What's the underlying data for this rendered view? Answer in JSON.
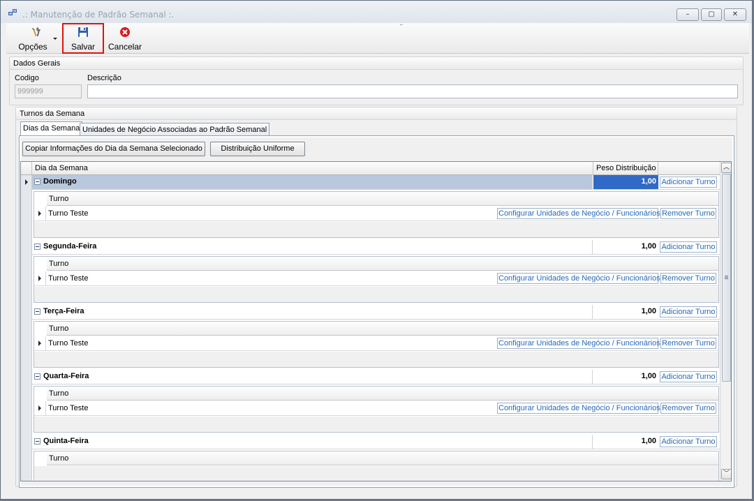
{
  "window": {
    "title": ".: Manutenção de Padrão Semanal :.",
    "controls": {
      "minimize": "–",
      "maximize": "▢",
      "close": "✕"
    }
  },
  "toolbar": {
    "options_label": "Opções",
    "save_label": "Salvar",
    "cancel_label": "Cancelar"
  },
  "general": {
    "title": "Dados Gerais",
    "codigo_label": "Codigo",
    "codigo_value": "999999",
    "descricao_label": "Descrição",
    "descricao_value": ""
  },
  "turnos": {
    "title": "Turnos da Semana",
    "tabs": [
      "Dias da Semana",
      "Unidades de Negócio Associadas ao Padrão Semanal"
    ],
    "copy_button": "Copiar Informações do Dia da Semana Selecionado",
    "uniform_button": "Distribuição Uniforme",
    "columns": [
      "Dia da Semana",
      "Peso Distribuição"
    ],
    "add_turno_label": "Adicionar Turno",
    "sub_column": "Turno",
    "configure_label": "Configurar Unidades de Negócio / Funcionários",
    "remove_label": "Remover Turno",
    "days": [
      {
        "name": "Domingo",
        "weight": "1,00",
        "turno": "Turno Teste"
      },
      {
        "name": "Segunda-Feira",
        "weight": "1,00",
        "turno": "Turno Teste"
      },
      {
        "name": "Terça-Feira",
        "weight": "1,00",
        "turno": "Turno Teste"
      },
      {
        "name": "Quarta-Feira",
        "weight": "1,00",
        "turno": "Turno Teste"
      },
      {
        "name": "Quinta-Feira",
        "weight": "1,00",
        "turno": ""
      }
    ]
  },
  "colors": {
    "selected_row": "#b9c8dd",
    "selected_cell": "#3169c6",
    "link_blue": "#2668b8",
    "highlight_border": "#e01010"
  }
}
